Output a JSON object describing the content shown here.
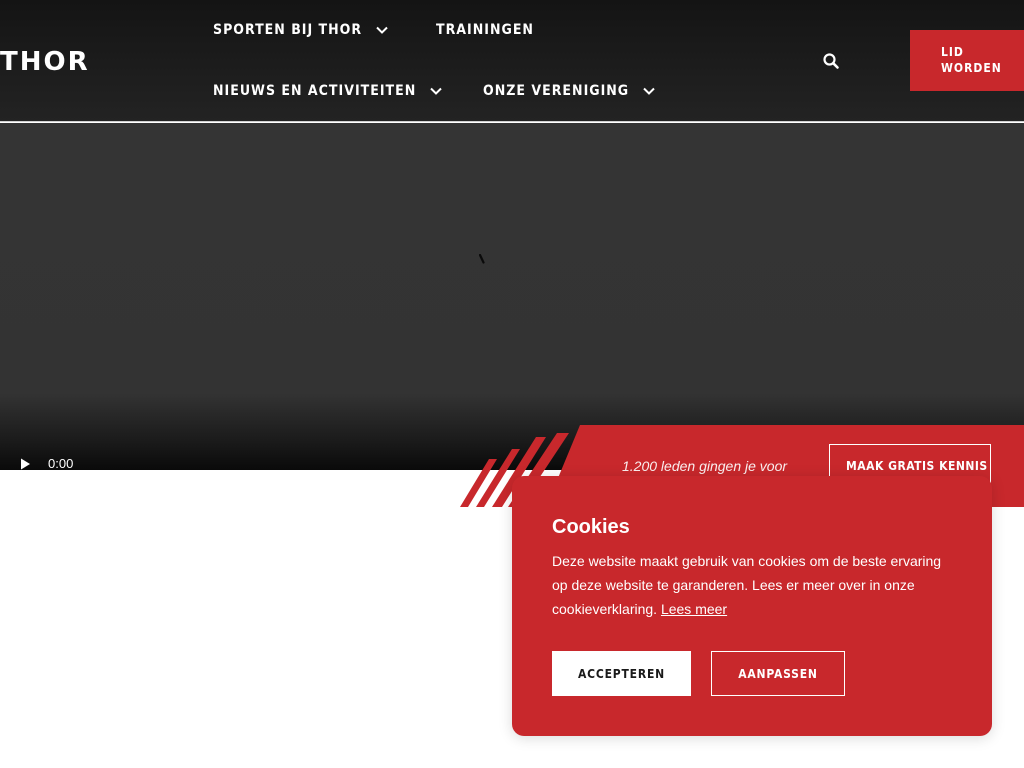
{
  "colors": {
    "brand_red": "#c8282c",
    "header_bg": "#1c1c1c",
    "video_bg": "#333333",
    "text_light": "#ffffff"
  },
  "header": {
    "logo": "THOR",
    "nav": [
      {
        "label": "SPORTEN BIJ THOR",
        "icon": "chevron-down-icon"
      },
      {
        "label": "TRAININGEN"
      },
      {
        "label": "NIEUWS EN ACTIVITEITEN",
        "icon": "chevron-down-icon"
      },
      {
        "label": "ONZE VERENIGING",
        "icon": "chevron-down-icon"
      }
    ],
    "search_icon": "search-icon",
    "cta_line1": "LID",
    "cta_line2": "WORDEN"
  },
  "video": {
    "time": "0:00",
    "play_icon": "play-icon",
    "loading_icon": "spinner-icon"
  },
  "banner": {
    "text": "1.200 leden gingen je voor",
    "button_label": "MAAK GRATIS KENNIS"
  },
  "cookie": {
    "title": "Cookies",
    "body": "Deze website maakt gebruik van cookies om de beste ervaring op deze website te garanderen. Lees er meer over in onze cookieverklaring.",
    "link_label": "Lees meer",
    "accept_label": "ACCEPTEREN",
    "adjust_label": "AANPASSEN"
  }
}
